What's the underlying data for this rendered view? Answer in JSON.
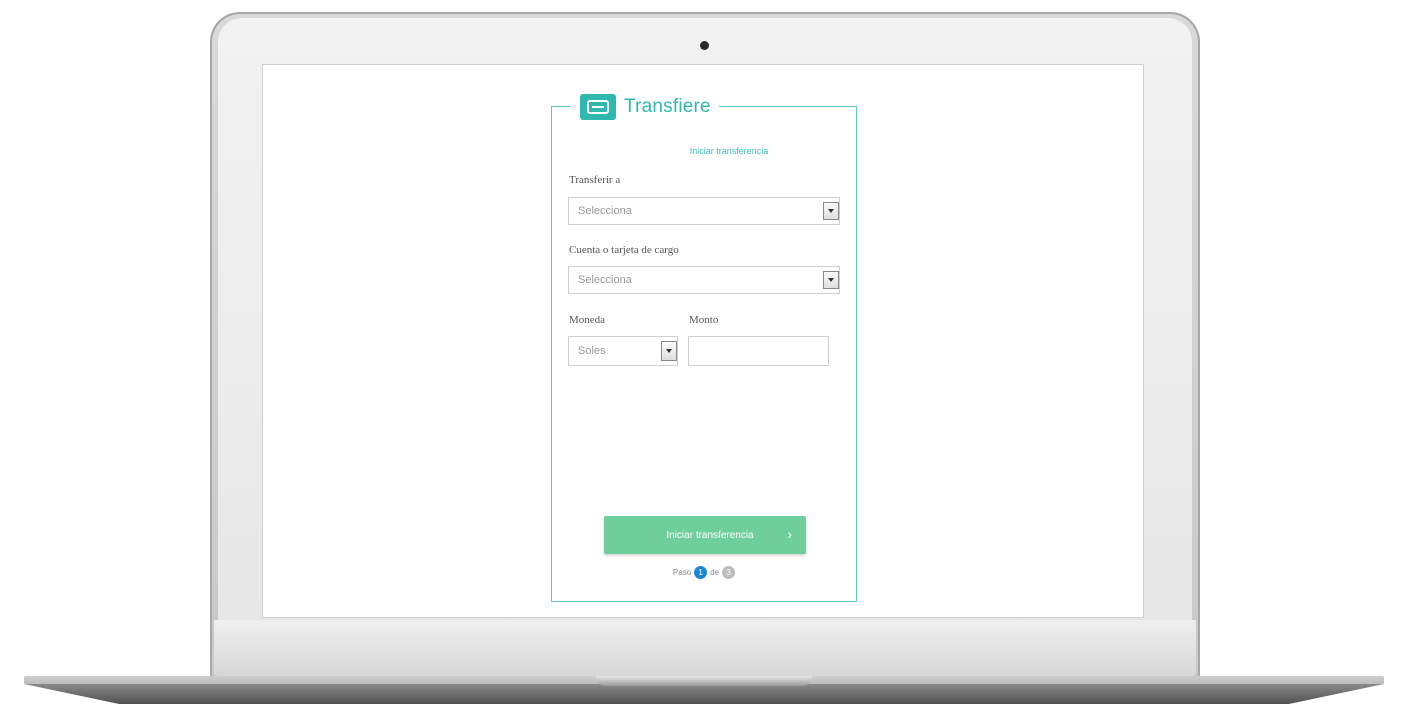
{
  "brand": {
    "name": "Transfiere",
    "icon": "transfer-arrows-icon",
    "color": "#2fb8ae"
  },
  "form": {
    "subtitle": "Iniciar transferencia",
    "transfer_to": {
      "label": "Transferir a",
      "value": "Selecciona"
    },
    "source_account": {
      "label": "Cuenta o tarjeta de cargo",
      "value": "Selecciona"
    },
    "currency": {
      "label": "Moneda",
      "value": "Soles"
    },
    "amount": {
      "label": "Monto",
      "value": ""
    },
    "submit": {
      "label": "Iniciar transferencia",
      "color": "#6fcf9a"
    },
    "steps": {
      "prefix": "Paso",
      "current": "1",
      "middle": "de",
      "total": "3"
    }
  }
}
